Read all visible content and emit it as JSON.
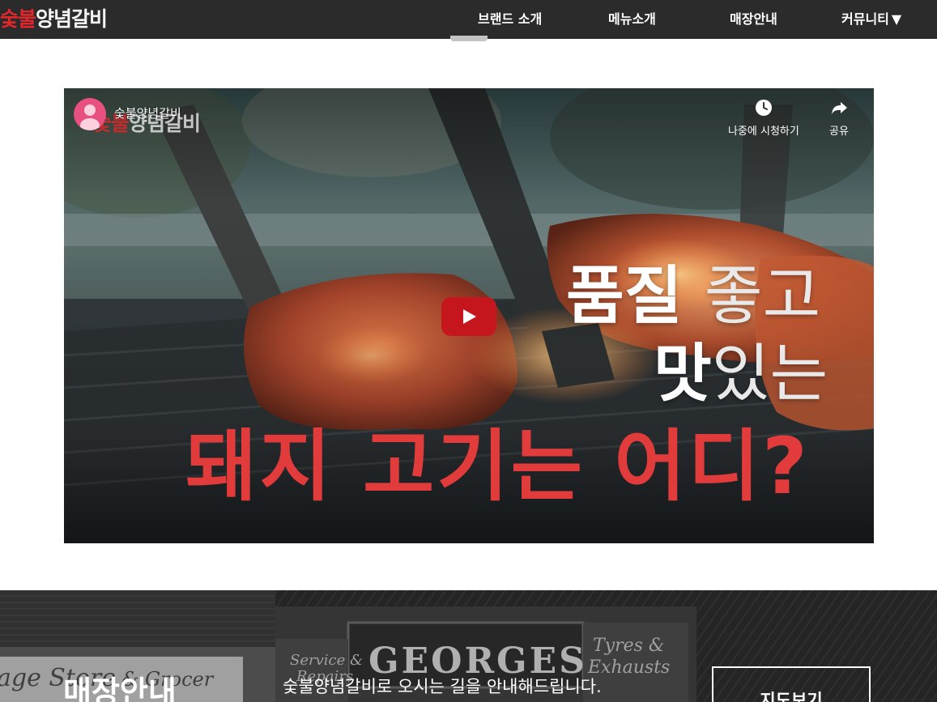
{
  "nav": {
    "logo_red": "숯불",
    "logo_white": "양념갈비",
    "items": [
      {
        "label": "브랜드 소개"
      },
      {
        "label": "메뉴소개"
      },
      {
        "label": "매장안내"
      },
      {
        "label": "커뮤니티",
        "arrow": "▼"
      }
    ]
  },
  "video": {
    "channel_name": "숯불양념갈비",
    "watch_later_label": "나중에 시청하기",
    "share_label": "공유",
    "caption": {
      "line1_bold": "품질",
      "line1_light": "좋고",
      "line2_bold": "맛",
      "line2_light": "있는",
      "line3": "돼지 고기는 어디?"
    },
    "icons": [
      "clock-icon",
      "share-icon",
      "play-icon",
      "avatar-icon"
    ]
  },
  "store": {
    "title": "매장안내",
    "description": "숯불양념갈비로 오시는 길을 안내해드립니다.",
    "map_button_label": "지도보기",
    "sign_text": "GEORGES",
    "sign_small_left": "Service & Repairs",
    "sign_small_right": "Tyres & Exhausts",
    "sign_store": "age Store & Grocer"
  },
  "colors": {
    "nav_bg": "#2b2b2b",
    "brand_red": "#e3262b",
    "caption_red": "#e23b3b",
    "play_red": "#c4161c"
  }
}
